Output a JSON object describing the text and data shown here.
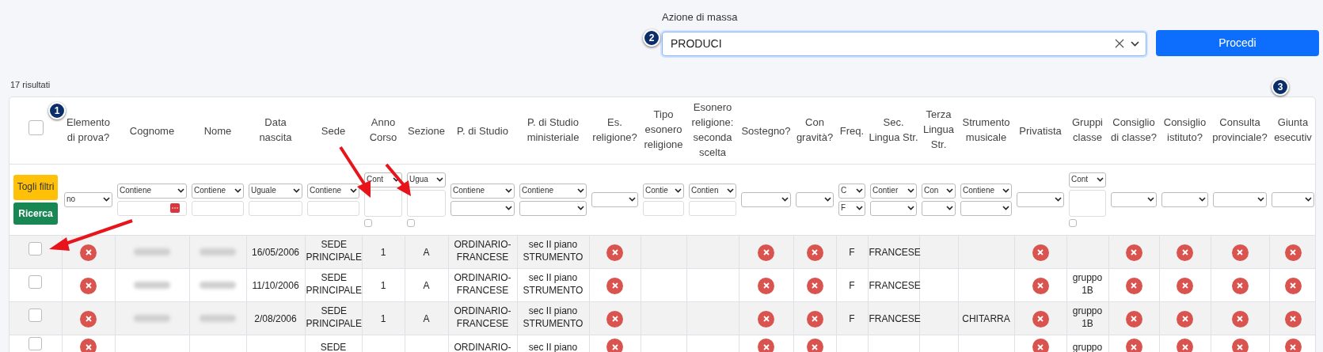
{
  "bulk_action": {
    "label": "Azione di massa",
    "value": "PRODUCI",
    "button": "Procedi"
  },
  "result_count": "17 risultati",
  "select_all": {
    "checked": false
  },
  "filter_buttons": [
    "Togli filtri",
    "Ricerca"
  ],
  "columns": [
    {
      "header": "Elemento di prova?",
      "filter": {
        "kind": "select",
        "value": "no"
      }
    },
    {
      "header": "Cognome",
      "filter": {
        "operator": "Contiene",
        "kind": "textwithicon"
      }
    },
    {
      "header": "Nome",
      "filter": {
        "operator": "Contiene",
        "kind": "text"
      }
    },
    {
      "header": "Data nascita",
      "filter": {
        "operator": "Uguale",
        "kind": "text"
      }
    },
    {
      "header": "Sede",
      "filter": {
        "operator": "Contiene",
        "kind": "text"
      }
    },
    {
      "header": "Anno Corso",
      "filter": {
        "operator": "Cont",
        "kind": "textarea",
        "checked": false
      }
    },
    {
      "header": "Sezione",
      "filter": {
        "operator": "Ugua",
        "kind": "textarea",
        "checked": false
      }
    },
    {
      "header": "P. di Studio",
      "filter": {
        "operator": "Contiene",
        "kind": "select"
      }
    },
    {
      "header": "P. di Studio ministeriale",
      "filter": {
        "operator": "Contiene",
        "kind": "select"
      }
    },
    {
      "header": "Es. religione?",
      "filter": {
        "kind": "select"
      }
    },
    {
      "header": "Tipo esonero religione",
      "filter": {
        "operator": "Contie",
        "kind": "text"
      }
    },
    {
      "header": "Esonero religione: seconda scelta",
      "filter": {
        "operator": "Contien",
        "kind": "text"
      }
    },
    {
      "header": "Sostegno?",
      "filter": {
        "kind": "select"
      }
    },
    {
      "header": "Con gravità?",
      "filter": {
        "kind": "select"
      }
    },
    {
      "header": "Freq.",
      "filter": {
        "operator": "C",
        "kind": "select",
        "value": "F"
      }
    },
    {
      "header": "Sec. Lingua Str.",
      "filter": {
        "operator": "Contier",
        "kind": "select"
      }
    },
    {
      "header": "Terza Lingua Str.",
      "filter": {
        "operator": "Con",
        "kind": "select"
      }
    },
    {
      "header": "Strumento musicale",
      "filter": {
        "operator": "Contiene",
        "kind": "select"
      }
    },
    {
      "header": "Privatista",
      "filter": {
        "kind": "select"
      }
    },
    {
      "header": "Gruppi classe",
      "filter": {
        "operator": "Cont",
        "kind": "textarea",
        "checked": false
      }
    },
    {
      "header": "Consiglio di classe?",
      "filter": {
        "kind": "select"
      }
    },
    {
      "header": "Consiglio istituto?",
      "filter": {
        "kind": "select"
      }
    },
    {
      "header": "Consulta provinciale?",
      "filter": {
        "kind": "select"
      }
    },
    {
      "header": "Giunta esecutiv",
      "filter": {
        "kind": "select"
      }
    }
  ],
  "rows": [
    {
      "selected": false,
      "cells": [
        {
          "kind": "flag",
          "on": false
        },
        {
          "kind": "redacted"
        },
        {
          "kind": "redacted"
        },
        {
          "kind": "text",
          "text": "16/05/2006"
        },
        {
          "kind": "text",
          "text": "SEDE PRINCIPALE"
        },
        {
          "kind": "text",
          "text": "1"
        },
        {
          "kind": "text",
          "text": "A"
        },
        {
          "kind": "text",
          "text": "ORDINARIO-FRANCESE"
        },
        {
          "kind": "text",
          "text": "sec II piano STRUMENTO"
        },
        {
          "kind": "flag",
          "on": false
        },
        {
          "kind": "empty"
        },
        {
          "kind": "empty"
        },
        {
          "kind": "flag",
          "on": false
        },
        {
          "kind": "flag",
          "on": false
        },
        {
          "kind": "text",
          "text": "F"
        },
        {
          "kind": "text",
          "text": "FRANCESE"
        },
        {
          "kind": "empty"
        },
        {
          "kind": "empty"
        },
        {
          "kind": "flag",
          "on": false
        },
        {
          "kind": "empty"
        },
        {
          "kind": "flag",
          "on": false
        },
        {
          "kind": "flag",
          "on": false
        },
        {
          "kind": "flag",
          "on": false
        },
        {
          "kind": "flag",
          "on": false
        }
      ]
    },
    {
      "selected": false,
      "cells": [
        {
          "kind": "flag",
          "on": false
        },
        {
          "kind": "redacted"
        },
        {
          "kind": "redacted"
        },
        {
          "kind": "text",
          "text": "11/10/2006"
        },
        {
          "kind": "text",
          "text": "SEDE PRINCIPALE"
        },
        {
          "kind": "text",
          "text": "1"
        },
        {
          "kind": "text",
          "text": "A"
        },
        {
          "kind": "text",
          "text": "ORDINARIO-FRANCESE"
        },
        {
          "kind": "text",
          "text": "sec II piano STRUMENTO"
        },
        {
          "kind": "flag",
          "on": false
        },
        {
          "kind": "empty"
        },
        {
          "kind": "empty"
        },
        {
          "kind": "flag",
          "on": false
        },
        {
          "kind": "flag",
          "on": false
        },
        {
          "kind": "text",
          "text": "F"
        },
        {
          "kind": "text",
          "text": "FRANCESE"
        },
        {
          "kind": "empty"
        },
        {
          "kind": "empty"
        },
        {
          "kind": "flag",
          "on": false
        },
        {
          "kind": "text",
          "text": "gruppo 1B"
        },
        {
          "kind": "flag",
          "on": false
        },
        {
          "kind": "flag",
          "on": false
        },
        {
          "kind": "flag",
          "on": false
        },
        {
          "kind": "flag",
          "on": false
        }
      ]
    },
    {
      "selected": false,
      "cells": [
        {
          "kind": "flag",
          "on": false
        },
        {
          "kind": "redacted"
        },
        {
          "kind": "redacted"
        },
        {
          "kind": "text",
          "text": "2/08/2006"
        },
        {
          "kind": "text",
          "text": "SEDE PRINCIPALE"
        },
        {
          "kind": "text",
          "text": "1"
        },
        {
          "kind": "text",
          "text": "A"
        },
        {
          "kind": "text",
          "text": "ORDINARIO-FRANCESE"
        },
        {
          "kind": "text",
          "text": "sec II piano STRUMENTO"
        },
        {
          "kind": "flag",
          "on": false
        },
        {
          "kind": "empty"
        },
        {
          "kind": "empty"
        },
        {
          "kind": "flag",
          "on": false
        },
        {
          "kind": "flag",
          "on": false
        },
        {
          "kind": "text",
          "text": "F"
        },
        {
          "kind": "text",
          "text": "FRANCESE"
        },
        {
          "kind": "empty"
        },
        {
          "kind": "text",
          "text": "CHITARRA"
        },
        {
          "kind": "flag",
          "on": false
        },
        {
          "kind": "text",
          "text": "gruppo 1B"
        },
        {
          "kind": "flag",
          "on": false
        },
        {
          "kind": "flag",
          "on": false
        },
        {
          "kind": "flag",
          "on": false
        },
        {
          "kind": "flag",
          "on": false
        }
      ]
    },
    {
      "selected": false,
      "cells": [
        {
          "kind": "flag",
          "on": false
        },
        {
          "kind": "empty"
        },
        {
          "kind": "empty"
        },
        {
          "kind": "empty"
        },
        {
          "kind": "text",
          "text": "SEDE"
        },
        {
          "kind": "empty"
        },
        {
          "kind": "empty"
        },
        {
          "kind": "text",
          "text": "ORDINARIO-"
        },
        {
          "kind": "text",
          "text": "sec II piano"
        },
        {
          "kind": "flag",
          "on": false
        },
        {
          "kind": "empty"
        },
        {
          "kind": "empty"
        },
        {
          "kind": "flag",
          "on": false
        },
        {
          "kind": "flag",
          "on": false
        },
        {
          "kind": "empty"
        },
        {
          "kind": "empty"
        },
        {
          "kind": "empty"
        },
        {
          "kind": "empty"
        },
        {
          "kind": "flag",
          "on": false
        },
        {
          "kind": "text",
          "text": "gruppo"
        },
        {
          "kind": "flag",
          "on": false
        },
        {
          "kind": "flag",
          "on": false
        },
        {
          "kind": "flag",
          "on": false
        },
        {
          "kind": "flag",
          "on": false
        }
      ]
    }
  ],
  "annotations": [
    "1",
    "2",
    "3"
  ]
}
